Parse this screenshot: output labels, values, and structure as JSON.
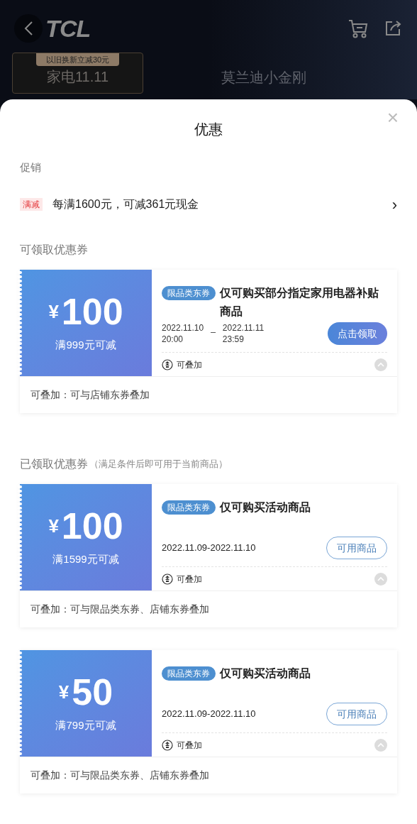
{
  "background": {
    "logo": "TCL",
    "banner_tag": "以旧换新立减30元",
    "banner_title": "家电11.11",
    "product_title": "莫兰迪小金刚"
  },
  "sheet": {
    "title": "优惠",
    "close": "×",
    "promotions": {
      "heading": "促销",
      "items": [
        {
          "tag": "满减",
          "text": "每满1600元，可减361元现金",
          "chevron": "›"
        }
      ]
    },
    "sections": [
      {
        "heading": "可领取优惠券",
        "coupons": [
          {
            "currency": "¥",
            "amount": "100",
            "condition": "满999元可减",
            "tag": "限品类东券",
            "title": "仅可购买部分指定家用电器补贴商品",
            "period": {
              "start_date": "2022.11.10",
              "start_time": "20:00",
              "separator": "_",
              "end_date": "2022.11.11",
              "end_time": "23:59"
            },
            "button": {
              "kind": "claim",
              "label": "点击领取"
            },
            "stack_label": "可叠加",
            "expanded": true,
            "detail": "可叠加：可与店铺东券叠加"
          }
        ]
      },
      {
        "heading": "已领取优惠券",
        "note": "（满足条件后即可用于当前商品）",
        "coupons": [
          {
            "currency": "¥",
            "amount": "100",
            "condition": "满1599元可减",
            "tag": "限品类东券",
            "title": "仅可购买活动商品",
            "dates": "2022.11.09-2022.11.10",
            "button": {
              "kind": "view",
              "label": "可用商品"
            },
            "stack_label": "可叠加",
            "expanded": true,
            "detail": "可叠加：可与限品类东券、店铺东券叠加"
          },
          {
            "currency": "¥",
            "amount": "50",
            "condition": "满799元可减",
            "tag": "限品类东券",
            "title": "仅可购买活动商品",
            "dates": "2022.11.09-2022.11.10",
            "button": {
              "kind": "view",
              "label": "可用商品"
            },
            "stack_label": "可叠加",
            "expanded": true,
            "detail": "可叠加：可与限品类东券、店铺东券叠加"
          }
        ]
      }
    ]
  }
}
